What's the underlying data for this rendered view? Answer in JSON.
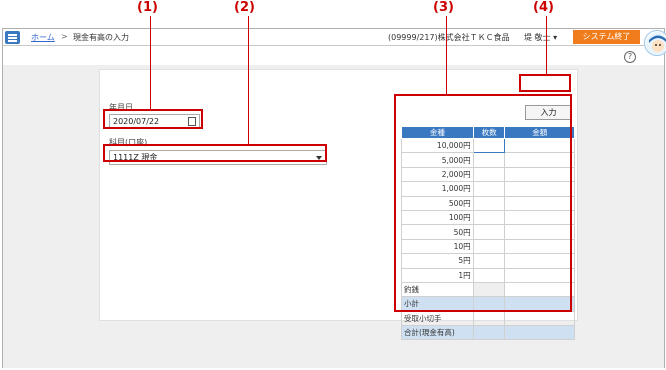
{
  "annotations": [
    "(1)",
    "(2)",
    "(3)",
    "(4)"
  ],
  "header": {
    "home_link": "ホーム",
    "separator": ">",
    "page_title": "現金有高の入力",
    "company": "(09999/217)株式会社ＴＫＣ食品",
    "user": "堤 敬士 ▾",
    "system_exit": "システム終了",
    "help": "?"
  },
  "form": {
    "date_label": "年月日",
    "date_value": "2020/07/22",
    "account_label": "科目(口座)",
    "account_value": "1111Z 現金"
  },
  "input_button": "入力",
  "table": {
    "headers": [
      "金種",
      "枚数",
      "金額"
    ],
    "denominations": [
      "10,000円",
      "5,000円",
      "2,000円",
      "1,000円",
      "500円",
      "100円",
      "50円",
      "10円",
      "5円",
      "1円"
    ],
    "extra_rows": [
      "釣銭",
      "小計",
      "受取小切手",
      "合計(現金有高)"
    ]
  }
}
